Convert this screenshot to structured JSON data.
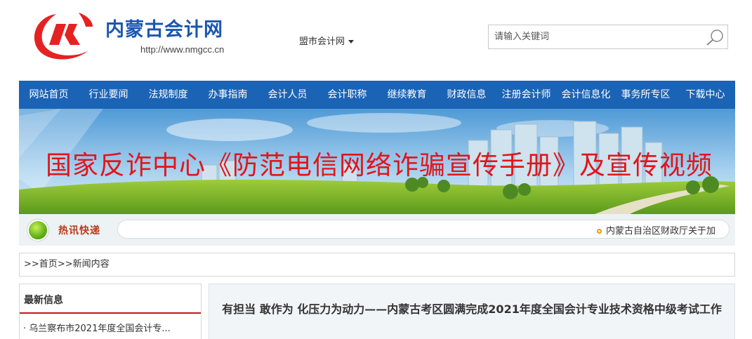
{
  "header": {
    "site_name": "内蒙古会计网",
    "site_url": "http://www.nmgcc.cn",
    "city_select_label": "盟市会计网",
    "search_placeholder": "请输入关键词"
  },
  "nav": {
    "items": [
      "网站首页",
      "行业要闻",
      "法规制度",
      "办事指南",
      "会计人员",
      "会计职称",
      "继续教育",
      "财政信息",
      "注册会计师",
      "会计信息化",
      "事务所专区",
      "下载中心"
    ]
  },
  "banner": {
    "title": "国家反诈中心《防范电信网络诈骗宣传手册》及宣传视频"
  },
  "ticker": {
    "label": "热讯快递",
    "item": "内蒙古自治区财政厅关于加"
  },
  "breadcrumb": {
    "sep1": ">>",
    "home": "首页",
    "sep2": ">>",
    "current": "新闻内容"
  },
  "sidebar": {
    "title": "最新信息",
    "items": [
      "· 乌兰察布市2021年度全国会计专..."
    ]
  },
  "article": {
    "title": "有担当 敢作为 化压力为动力——内蒙古考区圆满完成2021年度全国会计专业技术资格中级考试工作"
  },
  "colors": {
    "nav_bg": "#1b63b5",
    "banner_title": "#e2151a",
    "logo_red": "#e52222",
    "site_name_blue": "#1a56b0"
  }
}
